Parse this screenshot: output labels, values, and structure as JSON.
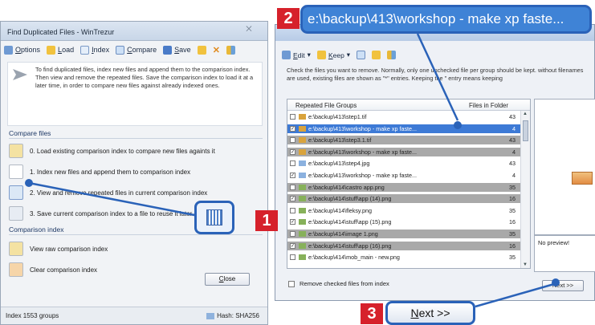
{
  "left_window": {
    "title": "Find Duplicated Files - WinTrezur",
    "close_glyph": "⨉",
    "toolbar": {
      "options": "Options",
      "load": "Load",
      "index": "Index",
      "compare": "Compare",
      "save": "Save"
    },
    "intro": "To find duplicated files, index new files and append them to the comparison index. Then view and remove the repeated files. Save the comparison index to load it at a later time, in order to compare new files against already indexed ones.",
    "compare_section": {
      "label": "Compare files",
      "items": [
        "0. Load existing comparison index to compare new files againts it",
        "1. Index new files and append them to comparison index",
        "2. View and remove repeated files in current comparison index",
        "3. Save current comparison index to a file to reuse it later on"
      ]
    },
    "index_section": {
      "label": "Comparison index",
      "items": [
        "View raw comparison index",
        "Clear comparison index"
      ]
    },
    "close_button": "Close",
    "status_left": "Index 1553 groups",
    "status_right": "Hash: SHA256"
  },
  "right_window": {
    "toolbar": {
      "edit": "Edit",
      "keep": "Keep"
    },
    "description": "Check the files you want to remove. Normally, only one unchecked file per group should be kept. without filenames are used, existing files are shown as \"*\" entries. Keeping the \" entry means keeping",
    "list": {
      "col_groups": "Repeated File Groups",
      "col_files": "Files in Folder",
      "rows": [
        {
          "name": "e:\\backup\\413\\step1.tif",
          "count": "43",
          "checked": false,
          "style": "normal",
          "icon": "img"
        },
        {
          "name": "e:\\backup\\413\\workshop - make xp faste...",
          "count": "4",
          "checked": true,
          "style": "selected",
          "icon": "img"
        },
        {
          "name": "e:\\backup\\413\\step3.1.tif",
          "count": "43",
          "checked": false,
          "style": "shade",
          "icon": "img"
        },
        {
          "name": "e:\\backup\\413\\workshop - make xp faste...",
          "count": "4",
          "checked": true,
          "style": "shade",
          "icon": "img"
        },
        {
          "name": "e:\\backup\\413\\step4.jpg",
          "count": "43",
          "checked": false,
          "style": "normal",
          "icon": "file"
        },
        {
          "name": "e:\\backup\\413\\workshop - make xp faste...",
          "count": "4",
          "checked": true,
          "style": "normal",
          "icon": "file"
        },
        {
          "name": "e:\\backup\\414\\castro app.png",
          "count": "35",
          "checked": false,
          "style": "shade",
          "icon": "png"
        },
        {
          "name": "e:\\backup\\414\\stuff\\app (14).png",
          "count": "16",
          "checked": true,
          "style": "shade",
          "icon": "png"
        },
        {
          "name": "e:\\backup\\414\\fleksy.png",
          "count": "35",
          "checked": false,
          "style": "normal",
          "icon": "png"
        },
        {
          "name": "e:\\backup\\414\\stuff\\app (15).png",
          "count": "16",
          "checked": true,
          "style": "normal",
          "icon": "png"
        },
        {
          "name": "e:\\backup\\414\\image 1.png",
          "count": "35",
          "checked": false,
          "style": "shade",
          "icon": "png"
        },
        {
          "name": "e:\\backup\\414\\stuff\\app (16).png",
          "count": "16",
          "checked": true,
          "style": "shade",
          "icon": "png"
        },
        {
          "name": "e:\\backup\\414\\mob_main - new.png",
          "count": "35",
          "checked": false,
          "style": "normal",
          "icon": "png"
        }
      ]
    },
    "preview_text": "No preview!",
    "remove_checkbox": "Remove checked files from index",
    "next_button": "Next >>"
  },
  "callouts": {
    "badge1": "1",
    "badge2": "2",
    "badge3": "3",
    "path_text": "e:\\backup\\413\\workshop - make xp faste...",
    "next_text": "Next >>"
  },
  "colors": {
    "callout_blue": "#2a62b8",
    "badge_red": "#d6212b",
    "selection_blue": "#3d7ad6"
  }
}
